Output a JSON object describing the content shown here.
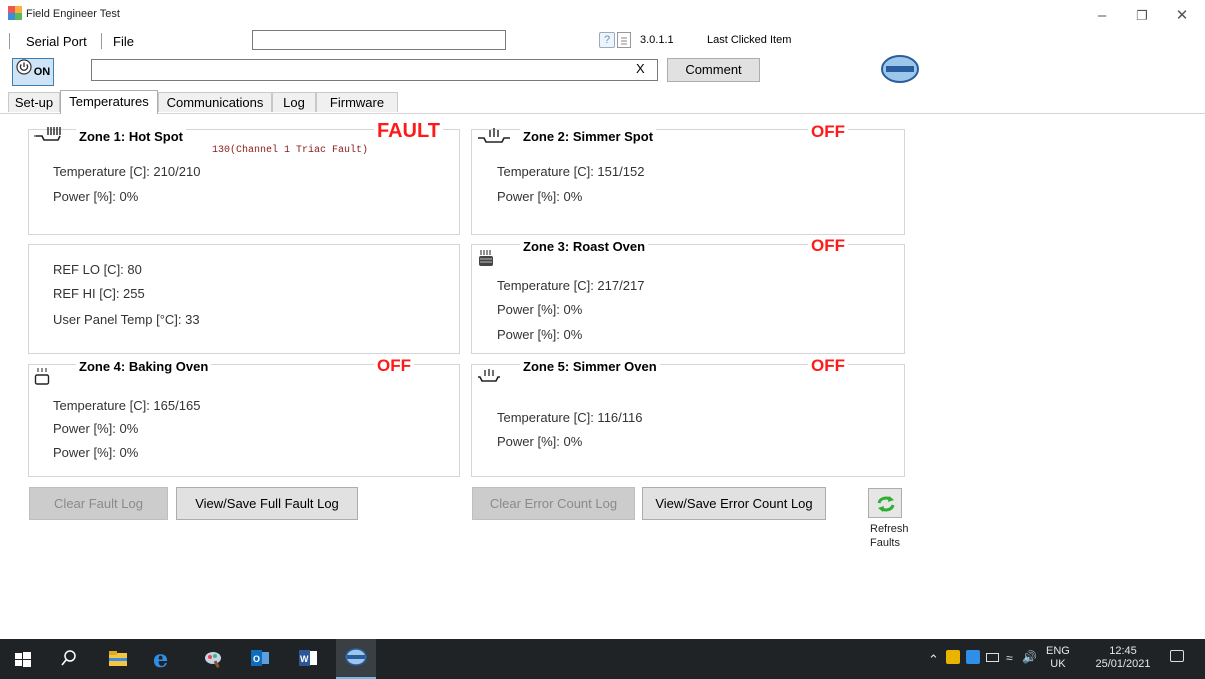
{
  "window": {
    "title": "Field Engineer Test"
  },
  "menu": {
    "serial_port": "Serial Port",
    "file": "File"
  },
  "toolbar": {
    "top_input_value": "",
    "version": "3.0.1.1",
    "last_clicked": "Last Clicked Item",
    "power_label": "ON",
    "comment_input_value": "",
    "clear_x": "X",
    "comment_button": "Comment"
  },
  "tabs": [
    {
      "label": "Set-up"
    },
    {
      "label": "Temperatures"
    },
    {
      "label": "Communications"
    },
    {
      "label": "Log"
    },
    {
      "label": "Firmware"
    }
  ],
  "zone1": {
    "title": "Zone 1: Hot Spot",
    "status": "FAULT",
    "fault_detail": "130(Channel 1 Triac Fault)",
    "temperature": "Temperature [C]: 210/210",
    "power": "Power [%]: 0%"
  },
  "zone2": {
    "title": "Zone 2: Simmer Spot",
    "status": "OFF",
    "temperature": "Temperature [C]: 151/152",
    "power": "Power [%]: 0%"
  },
  "reference": {
    "ref_lo": "REF LO [C]: 80",
    "ref_hi": "REF HI [C]: 255",
    "panel_temp": "User Panel Temp [°C]: 33"
  },
  "zone3": {
    "title": "Zone 3: Roast Oven",
    "status": "OFF",
    "temperature": "Temperature [C]: 217/217",
    "power1": "Power [%]: 0%",
    "power2": "Power [%]: 0%"
  },
  "zone4": {
    "title": "Zone 4: Baking Oven",
    "status": "OFF",
    "temperature": "Temperature [C]: 165/165",
    "power1": "Power [%]: 0%",
    "power2": "Power [%]: 0%"
  },
  "zone5": {
    "title": "Zone 5: Simmer Oven",
    "status": "OFF",
    "temperature": "Temperature [C]: 116/116",
    "power": "Power [%]: 0%"
  },
  "actions": {
    "clear_fault_log": "Clear Fault Log",
    "view_save_fault_log": "View/Save Full Fault Log",
    "clear_error_count_log": "Clear Error Count Log",
    "view_save_error_count_log": "View/Save Error Count Log",
    "refresh_line1": "Refresh",
    "refresh_line2": "Faults"
  },
  "taskbar": {
    "lang1": "ENG",
    "lang2": "UK",
    "time": "12:45",
    "date": "25/01/2021"
  },
  "colors": {
    "status_red": "#ff1a1a",
    "taskbar_bg": "#202325",
    "fault_detail": "#8b1a1a"
  },
  "icons": [
    "app-icon",
    "help-icon",
    "document-icon",
    "power-icon",
    "company-logo-icon",
    "hotspot-icon",
    "simmer-spot-icon",
    "roast-oven-icon",
    "baking-oven-icon",
    "simmer-oven-icon",
    "refresh-icon",
    "windows-start-icon",
    "search-icon",
    "file-explorer-icon",
    "edge-icon",
    "paint-icon",
    "outlook-icon",
    "word-icon",
    "app-taskbar-icon"
  ]
}
